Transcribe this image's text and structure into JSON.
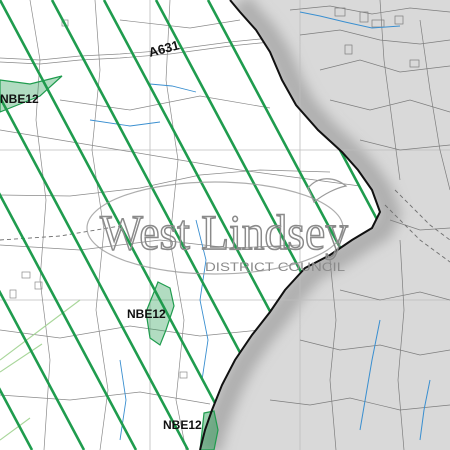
{
  "map": {
    "colors": {
      "inside_area": "#ffffff",
      "outside_area": "#d9d9d9",
      "boundary": "#111111",
      "hatch": "#1f9c4e",
      "nbe_fill": "#1f9c4e",
      "features": "#808080",
      "water": "#3a8fd0",
      "grid": "#bdbdbd"
    },
    "labels": {
      "road_a631": "A631",
      "nbe_left": "NBE12",
      "nbe_center": "NBE12",
      "nbe_bottom": "NBE12"
    },
    "watermark": {
      "name": "West Lindsey",
      "subtitle": "DISTRICT COUNCIL"
    }
  }
}
